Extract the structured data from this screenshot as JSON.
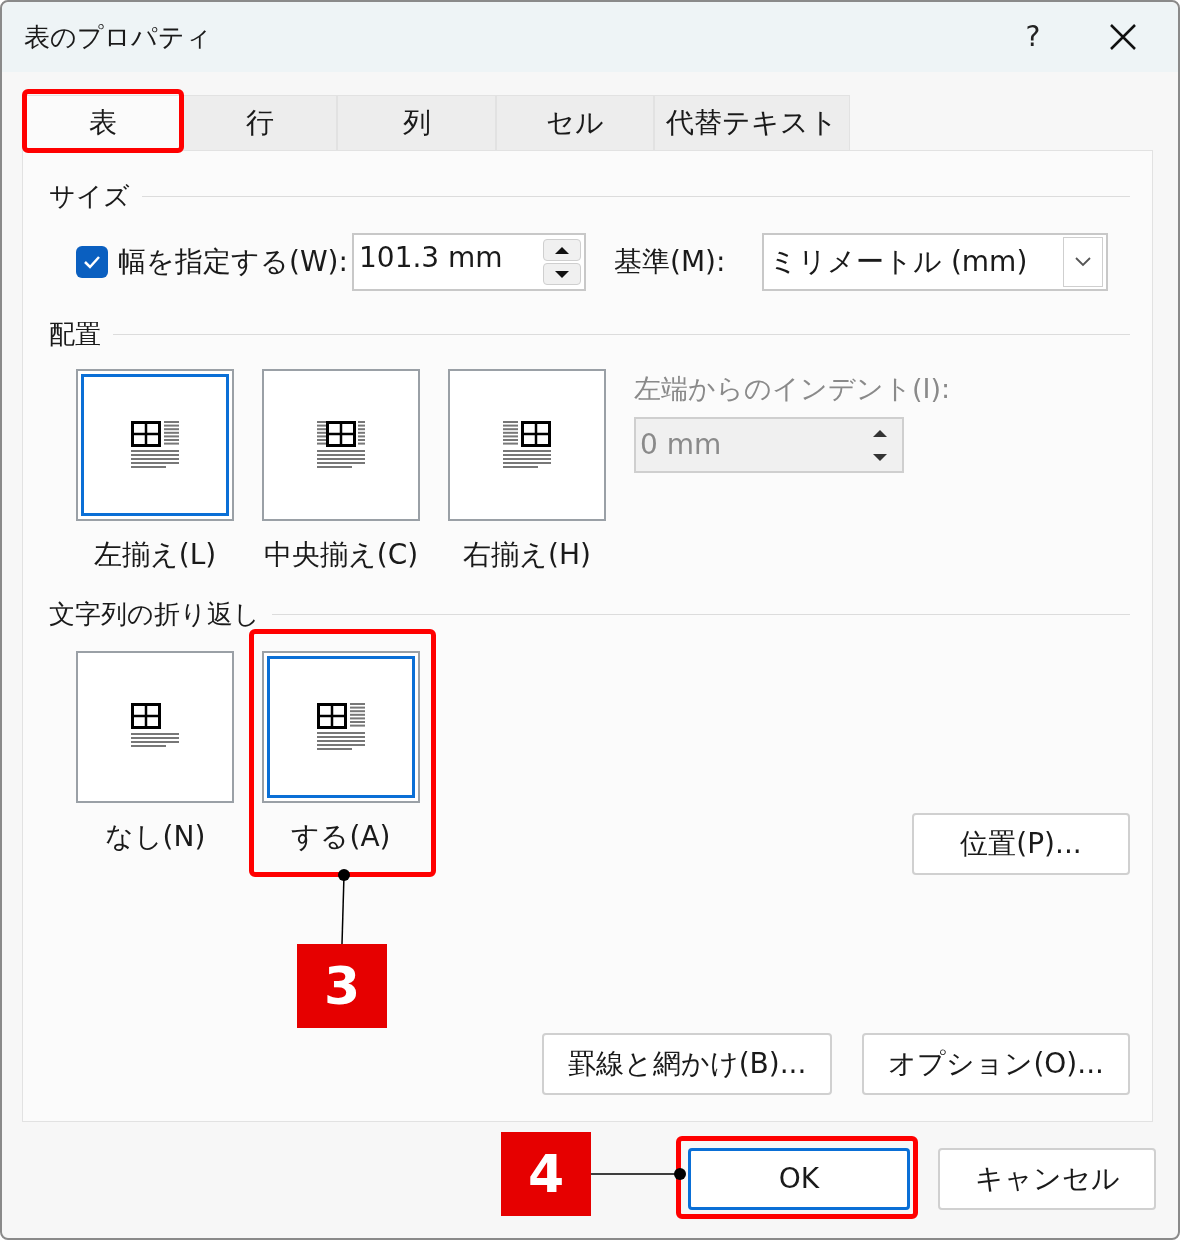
{
  "window": {
    "title": "表のプロパティ",
    "help": "?"
  },
  "tabs": [
    {
      "label": "表",
      "selected": true
    },
    {
      "label": "行",
      "selected": false
    },
    {
      "label": "列",
      "selected": false
    },
    {
      "label": "セル",
      "selected": false
    },
    {
      "label": "代替テキスト",
      "selected": false
    }
  ],
  "size_section": {
    "heading": "サイズ",
    "width_checkbox": {
      "label": "幅を指定する(W):",
      "checked": true
    },
    "width_value": "101.3 mm",
    "unit_label": "基準(M):",
    "unit_value": "ミリメートル (mm)"
  },
  "alignment_section": {
    "heading": "配置",
    "options": [
      {
        "label": "左揃え(L)",
        "selected": true,
        "kind": "left"
      },
      {
        "label": "中央揃え(C)",
        "selected": false,
        "kind": "center"
      },
      {
        "label": "右揃え(H)",
        "selected": false,
        "kind": "right"
      }
    ],
    "indent": {
      "label": "左端からのインデント(I):",
      "value": "0 mm",
      "disabled": true
    }
  },
  "wrapping_section": {
    "heading": "文字列の折り返し",
    "options": [
      {
        "label": "なし(N)",
        "selected": false,
        "kind": "none"
      },
      {
        "label": "する(A)",
        "selected": true,
        "kind": "around"
      }
    ],
    "position_button": "位置(P)..."
  },
  "footer_buttons": [
    "罫線と網かけ(B)...",
    "オプション(O)..."
  ],
  "dialog_buttons": [
    {
      "label": "OK",
      "default": true
    },
    {
      "label": "キャンセル",
      "default": false
    }
  ],
  "annotations": [
    "3",
    "4"
  ]
}
